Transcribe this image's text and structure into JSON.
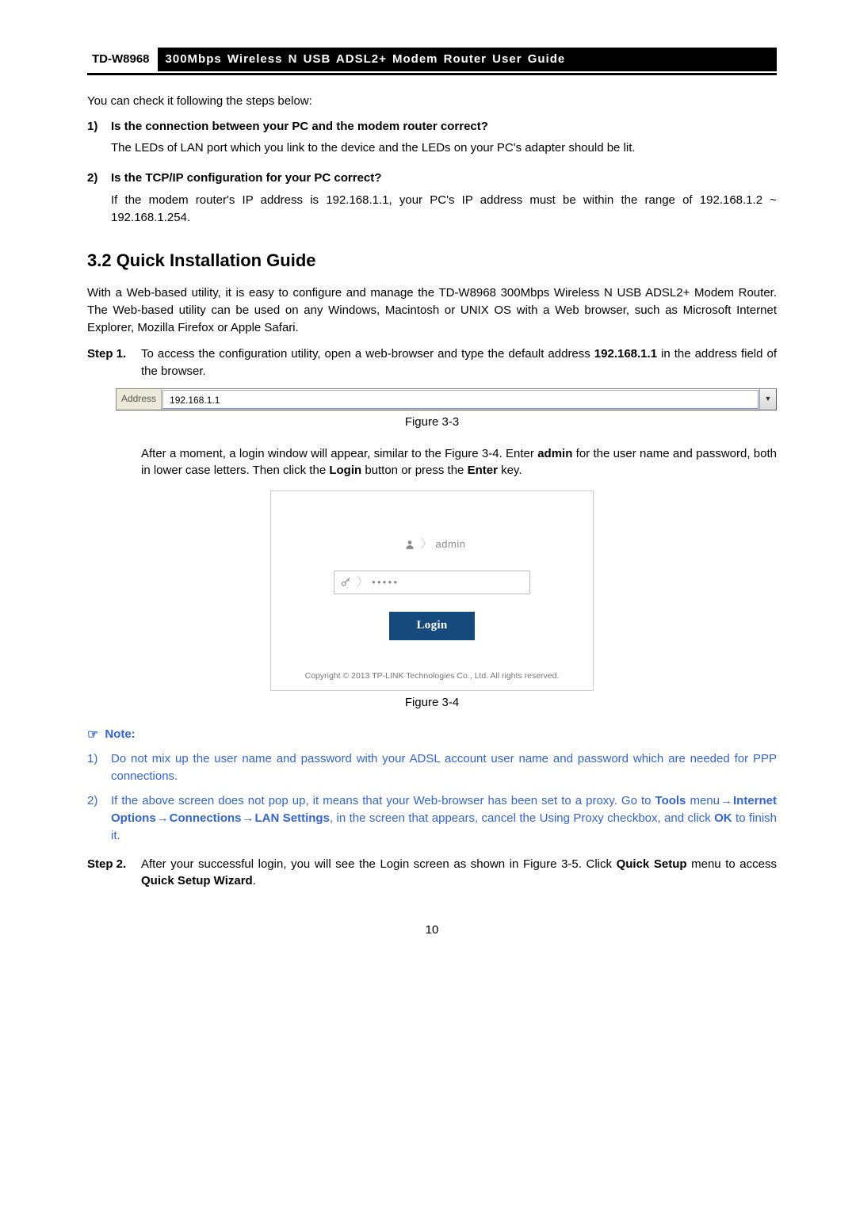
{
  "header": {
    "model": "TD-W8968",
    "title": "300Mbps Wireless N USB ADSL2+ Modem Router User Guide"
  },
  "intro": "You can check it following the steps below:",
  "checks": [
    {
      "num": "1)",
      "title": "Is the connection between your PC and the modem router correct?",
      "text": "The LEDs of LAN port which you link to the device and the LEDs on your PC's adapter should be lit."
    },
    {
      "num": "2)",
      "title": "Is the TCP/IP configuration for your PC correct?",
      "text": "If the modem router's IP address is 192.168.1.1, your PC's IP address must be within the range of 192.168.1.2 ~ 192.168.1.254."
    }
  ],
  "section_heading": "3.2  Quick Installation Guide",
  "section_intro": "With a Web-based utility, it is easy to configure and manage the TD-W8968 300Mbps Wireless N USB ADSL2+ Modem Router. The Web-based utility can be used on any Windows, Macintosh or UNIX OS with a Web browser, such as Microsoft Internet Explorer, Mozilla Firefox or Apple Safari.",
  "step1": {
    "label": "Step 1.",
    "text_pre": "To access the configuration utility, open a web-browser and type the default address ",
    "addr_bold": "192.168.1.1",
    "text_post": " in the address field of the browser."
  },
  "addrbar": {
    "label": "Address",
    "value": "192.168.1.1"
  },
  "fig33": "Figure 3-3",
  "after_addr": {
    "pre": "After a moment, a login window will appear, similar to the Figure 3-4. Enter ",
    "b1": "admin",
    "mid1": " for the user name and password, both in lower case letters. Then click the ",
    "b2": "Login",
    "mid2": " button or press the ",
    "b3": "Enter",
    "post": " key."
  },
  "login": {
    "username": "admin",
    "password": "●●●●●",
    "button": "Login",
    "copyright": "Copyright © 2013 TP-LINK Technologies Co., Ltd. All rights reserved."
  },
  "fig34": "Figure 3-4",
  "note_label": "Note:",
  "notes": [
    {
      "num": "1)",
      "text": "Do not mix up the user name and password with your ADSL account user name and password which are needed for PPP connections."
    },
    {
      "num": "2)",
      "pre": "If the above screen does not pop up, it means that your Web-browser has been set to a proxy. Go to ",
      "b1": "Tools",
      "mid1": " menu",
      "arrow": "→",
      "b2": "Internet Options",
      "b3": "Connections",
      "b4": "LAN Settings",
      "mid2": ", in the screen that appears, cancel the Using Proxy checkbox, and click ",
      "b5": "OK",
      "post": " to finish it."
    }
  ],
  "step2": {
    "label": "Step 2.",
    "pre": "After your successful login, you will see the Login screen as shown in Figure 3-5. Click ",
    "b1": "Quick Setup",
    "mid": " menu to access ",
    "b2": "Quick Setup Wizard",
    "post": "."
  },
  "page_number": "10"
}
